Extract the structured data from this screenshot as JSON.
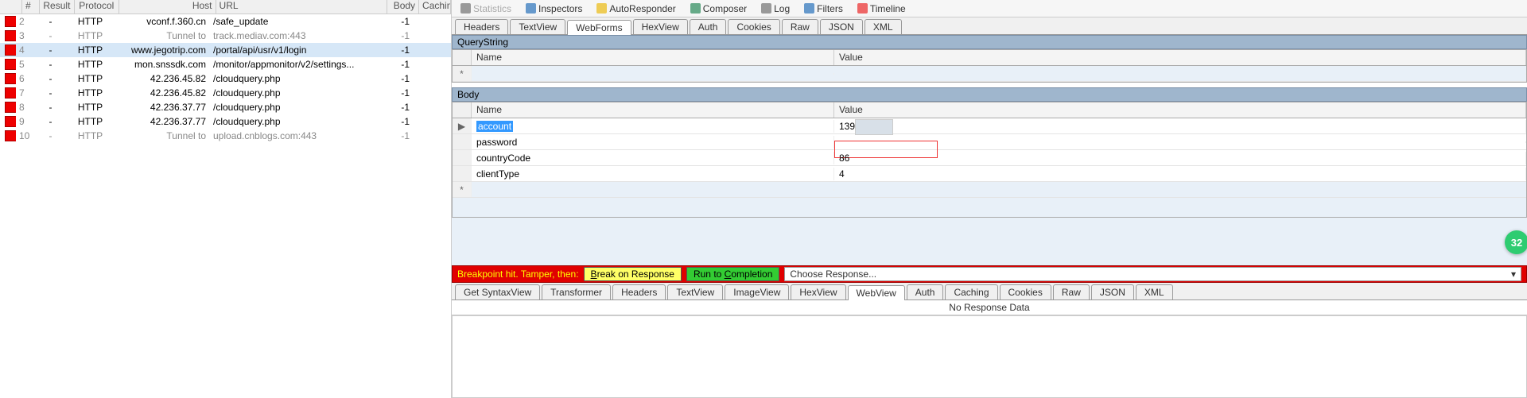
{
  "sessions": {
    "headers": {
      "num": "#",
      "result": "Result",
      "protocol": "Protocol",
      "host": "Host",
      "url": "URL",
      "body": "Body",
      "caching": "Caching"
    },
    "rows": [
      {
        "n": "2",
        "result": "-",
        "protocol": "HTTP",
        "host": "vconf.f.360.cn",
        "url": "/safe_update",
        "body": "-1",
        "gray": false
      },
      {
        "n": "3",
        "result": "-",
        "protocol": "HTTP",
        "host": "Tunnel to",
        "url": "track.mediav.com:443",
        "body": "-1",
        "gray": true
      },
      {
        "n": "4",
        "result": "-",
        "protocol": "HTTP",
        "host": "www.jegotrip.com",
        "url": "/portal/api/usr/v1/login",
        "body": "-1",
        "selected": true
      },
      {
        "n": "5",
        "result": "-",
        "protocol": "HTTP",
        "host": "mon.snssdk.com",
        "url": "/monitor/appmonitor/v2/settings...",
        "body": "-1"
      },
      {
        "n": "6",
        "result": "-",
        "protocol": "HTTP",
        "host": "42.236.45.82",
        "url": "/cloudquery.php",
        "body": "-1"
      },
      {
        "n": "7",
        "result": "-",
        "protocol": "HTTP",
        "host": "42.236.45.82",
        "url": "/cloudquery.php",
        "body": "-1"
      },
      {
        "n": "8",
        "result": "-",
        "protocol": "HTTP",
        "host": "42.236.37.77",
        "url": "/cloudquery.php",
        "body": "-1"
      },
      {
        "n": "9",
        "result": "-",
        "protocol": "HTTP",
        "host": "42.236.37.77",
        "url": "/cloudquery.php",
        "body": "-1"
      },
      {
        "n": "10",
        "result": "-",
        "protocol": "HTTP",
        "host": "Tunnel to",
        "url": "upload.cnblogs.com:443",
        "body": "-1",
        "gray": true
      }
    ]
  },
  "toolbar": {
    "statistics": "Statistics",
    "inspectors": "Inspectors",
    "autoresponder": "AutoResponder",
    "composer": "Composer",
    "log": "Log",
    "filters": "Filters",
    "timeline": "Timeline"
  },
  "req_tabs": [
    "Headers",
    "TextView",
    "WebForms",
    "HexView",
    "Auth",
    "Cookies",
    "Raw",
    "JSON",
    "XML"
  ],
  "req_tab_active": "WebForms",
  "querystring": {
    "title": "QueryString",
    "cols": {
      "name": "Name",
      "value": "Value"
    }
  },
  "body": {
    "title": "Body",
    "cols": {
      "name": "Name",
      "value": "Value"
    },
    "rows": [
      {
        "name": "account",
        "value": "139          .35",
        "selected": true,
        "valueBlurred": true
      },
      {
        "name": "password",
        "value": "",
        "redbox": true
      },
      {
        "name": "countryCode",
        "value": "86"
      },
      {
        "name": "clientType",
        "value": "4"
      }
    ]
  },
  "breakbar": {
    "label": "Breakpoint hit. Tamper, then:",
    "breakBtn": "Break on Response",
    "runBtn": "Run to Completion",
    "choose": "Choose Response..."
  },
  "resp_tabs": [
    "Get SyntaxView",
    "Transformer",
    "Headers",
    "TextView",
    "ImageView",
    "HexView",
    "WebView",
    "Auth",
    "Caching",
    "Cookies",
    "Raw",
    "JSON",
    "XML"
  ],
  "resp_tab_active": "WebView",
  "noresp": "No Response Data",
  "badge": "32"
}
